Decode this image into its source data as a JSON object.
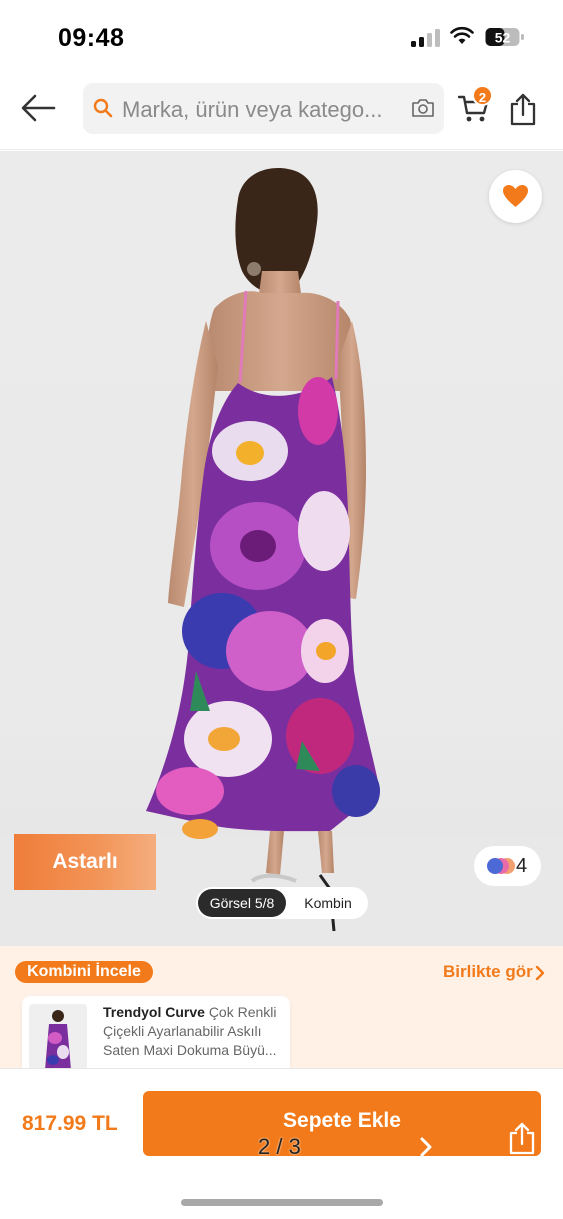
{
  "status_bar": {
    "time": "09:48",
    "battery": "52"
  },
  "header": {
    "search_placeholder": "Marka, ürün veya katego...",
    "cart_count": "2"
  },
  "product_image": {
    "badge": "Astarlı",
    "color_count": "4",
    "gallery_active_tab": "Görsel 5/8",
    "gallery_other_tab": "Kombin"
  },
  "kombin": {
    "badge": "Kombini İncele",
    "link": "Birlikte gör",
    "card": {
      "brand": "Trendyol Curve",
      "title": "Çok Renkli Çiçekli Ayarlanabilir Askılı Saten Maxi Dokuma Büyü..."
    }
  },
  "bottom": {
    "price": "817.99 TL",
    "add_to_cart": "Sepete Ekle",
    "page_indicator": "2 / 3"
  },
  "colors": {
    "accent": "#f27a1a",
    "badge_bg": "#fff1e6"
  }
}
